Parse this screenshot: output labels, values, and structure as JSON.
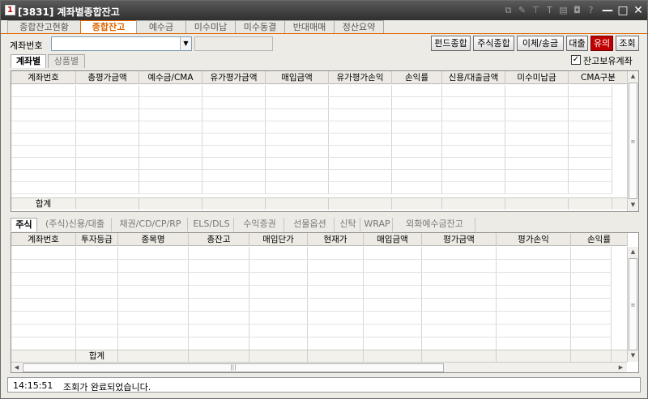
{
  "window": {
    "logo": "1",
    "title": "[3831] 계좌별종합잔고",
    "tool_icons": [
      "link-icon",
      "edit-icon",
      "pin-icon",
      "font-icon",
      "copy-icon",
      "camera-icon",
      "help-icon"
    ],
    "minimize": "—",
    "maximize": "□",
    "close": "✕"
  },
  "top_tabs": [
    {
      "label": "종합잔고현황",
      "active": false
    },
    {
      "label": "종합잔고",
      "active": true
    },
    {
      "label": "예수금",
      "active": false
    },
    {
      "label": "미수미납",
      "active": false
    },
    {
      "label": "미수동결",
      "active": false
    },
    {
      "label": "반대매매",
      "active": false
    },
    {
      "label": "정산요약",
      "active": false
    }
  ],
  "account": {
    "label": "계좌번호",
    "value": "",
    "name_value": ""
  },
  "buttons": [
    {
      "label": "펀드종합"
    },
    {
      "label": "주식종합"
    },
    {
      "label": "이체/송금"
    },
    {
      "label": "대출"
    },
    {
      "label": "유의"
    },
    {
      "label": "조회"
    }
  ],
  "sub_tabs": [
    {
      "label": "계좌별"
    },
    {
      "label": "상품별"
    }
  ],
  "checkbox": {
    "label": "잔고보유계좌",
    "checked": true,
    "mark": "✓"
  },
  "upper_grid": {
    "columns": [
      "계좌번호",
      "총평가금액",
      "예수금/CMA",
      "유가평가금액",
      "매입금액",
      "유가평가손익",
      "손익률",
      "신용/대출금액",
      "미수미납금",
      "CMA구분"
    ],
    "sum_label": "합계"
  },
  "bottom_tabs": [
    "주식",
    "(주식)신용/대출",
    "채권/CD/CP/RP",
    "ELS/DLS",
    "수익증권",
    "선물옵션",
    "신탁",
    "WRAP",
    "외화예수금잔고"
  ],
  "lower_grid": {
    "columns": [
      "계좌번호",
      "투자등급",
      "종목명",
      "총잔고",
      "매입단가",
      "현재가",
      "매입금액",
      "평가금액",
      "평가손익",
      "손익률"
    ],
    "sum_label": "합계"
  },
  "status": {
    "time": "14:15:51",
    "message": "조회가 완료되었습니다."
  },
  "colors": {
    "accent": "#e06600",
    "red_button": "#c00000",
    "titlebar": "#3a3a3a"
  }
}
